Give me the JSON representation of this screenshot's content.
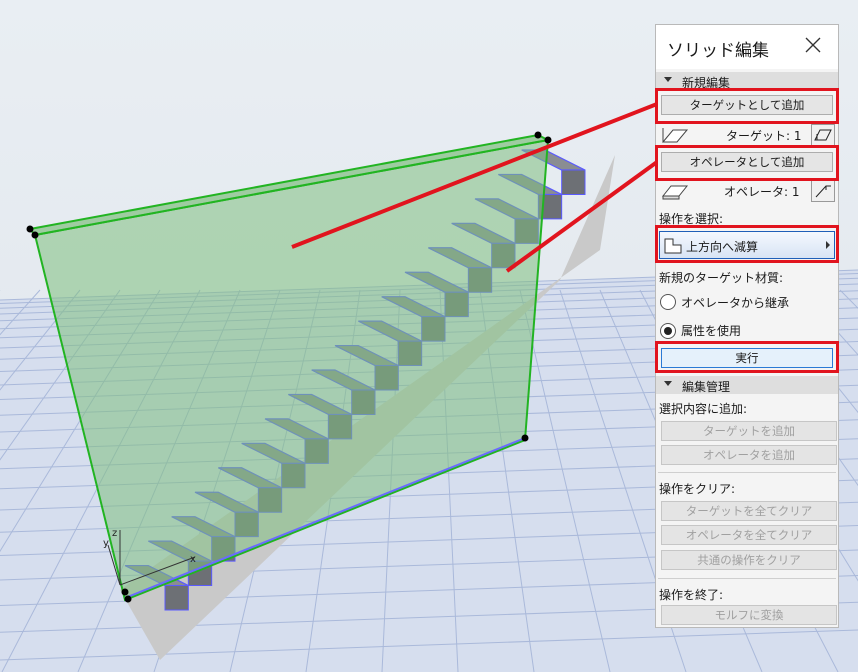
{
  "panel": {
    "title": "ソリッド編集",
    "sections": {
      "new_edit": "新規編集",
      "edit_manage": "編集管理"
    },
    "add_as_target": "ターゲットとして追加",
    "target_count": "ターゲット: 1",
    "add_as_operator": "オペレータとして追加",
    "operator_count": "オペレータ: 1",
    "select_operation_label": "操作を選択:",
    "operation_selected": "上方向へ減算",
    "new_target_material_label": "新規のターゲット材質:",
    "material_options": [
      {
        "label": "オペレータから継承",
        "selected": false
      },
      {
        "label": "属性を使用",
        "selected": true
      }
    ],
    "execute": "実行",
    "add_to_selection_label": "選択内容に追加:",
    "add_target": "ターゲットを追加",
    "add_operator": "オペレータを追加",
    "clear_operation_label": "操作をクリア:",
    "clear_all_targets": "ターゲットを全てクリア",
    "clear_all_operators": "オペレータを全てクリア",
    "clear_common_ops": "共通の操作をクリア",
    "end_operation_label": "操作を終了:",
    "convert_to_morph": "モルフに変換"
  },
  "viewport": {
    "axis_labels": {
      "z": "z",
      "y": "y",
      "x": "x"
    }
  },
  "colors": {
    "highlight": "#e1141e",
    "operator_plane": "#7fbf7f",
    "plane_edge": "#22b422",
    "stair_edge": "#5a5aff",
    "grid": "#aab9da"
  },
  "icons": [
    "close-icon",
    "target-shape-icon",
    "target-pick-icon",
    "operator-shape-icon",
    "operator-pick-icon",
    "subtract-upwards-icon",
    "submenu-arrow-icon"
  ]
}
